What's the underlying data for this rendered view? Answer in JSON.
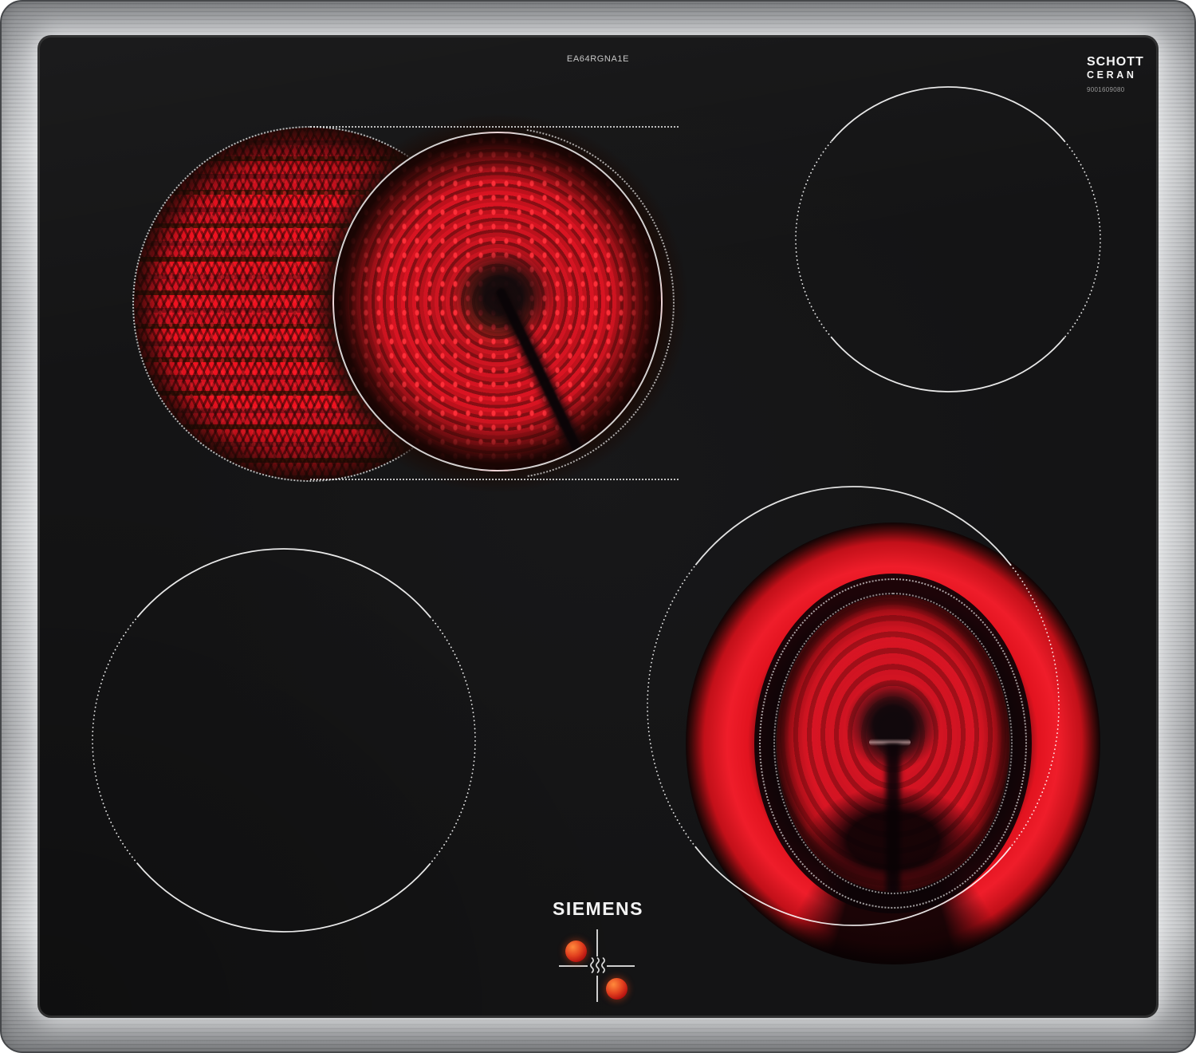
{
  "product": {
    "brand": "SIEMENS",
    "model_code": "EA64RGNA1E",
    "glass_branding": {
      "line1": "SCHOTT",
      "line2": "CERAN",
      "code": "9001609080"
    }
  },
  "surface": {
    "type": "glass-ceramic hob with stainless steel frame",
    "frame_color": "#b5b7ba",
    "glass_color": "#141415",
    "zone_outline_color": "#e8e8e8",
    "glow_color": "#e2131f"
  },
  "zones": [
    {
      "id": "rear-left",
      "description": "dual-circuit extended zone",
      "state": "on",
      "glowing": true
    },
    {
      "id": "rear-right",
      "description": "single radiant zone",
      "state": "off",
      "glowing": false
    },
    {
      "id": "front-left",
      "description": "single radiant zone",
      "state": "off",
      "glowing": false
    },
    {
      "id": "front-right",
      "description": "single radiant zone",
      "state": "on",
      "glowing": true
    }
  ],
  "residual_heat_indicator": {
    "dots_lit": 2,
    "symbol": "heat-waves",
    "dot_color": "#d8491f"
  }
}
